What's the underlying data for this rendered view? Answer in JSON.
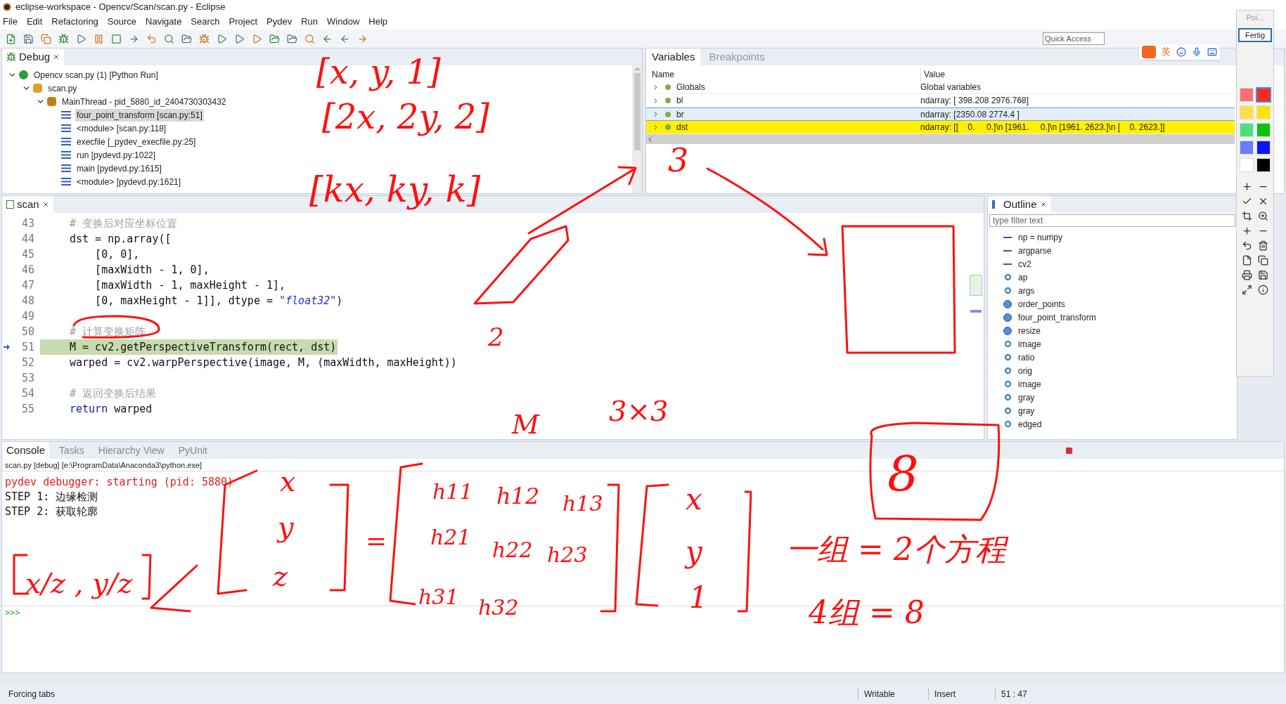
{
  "window": {
    "title": "eclipse-workspace - Opencv/Scan/scan.py - Eclipse"
  },
  "menu": [
    "File",
    "Edit",
    "Refactoring",
    "Source",
    "Navigate",
    "Search",
    "Project",
    "Pydev",
    "Run",
    "Window",
    "Help"
  ],
  "quick_access": {
    "placeholder": "Quick Access"
  },
  "ime_bar": {
    "mode": "英"
  },
  "palette": {
    "title": "Poi...",
    "done_button": "Fertig",
    "swatches": [
      {
        "color": "#f87171",
        "selected": false
      },
      {
        "color": "#ff2a1a",
        "selected": true
      },
      {
        "color": "#fde047",
        "selected": false
      },
      {
        "color": "#ffe600",
        "selected": false
      },
      {
        "color": "#4ade80",
        "selected": false
      },
      {
        "color": "#10c010",
        "selected": false
      },
      {
        "color": "#6b7cff",
        "selected": false
      },
      {
        "color": "#0a14ff",
        "selected": false
      },
      {
        "color": "#ffffff",
        "selected": false
      },
      {
        "color": "#000000",
        "selected": false
      }
    ]
  },
  "debug": {
    "title": "Debug",
    "tree": [
      {
        "label": "Opencv scan.py (1) [Python Run]",
        "kind": "launch",
        "expanded": true,
        "selected": false,
        "children": [
          {
            "label": "scan.py",
            "kind": "process",
            "expanded": true,
            "selected": false,
            "children": [
              {
                "label": "MainThread - pid_5880_id_2404730303432",
                "kind": "thread",
                "expanded": true,
                "selected": false,
                "children": [
                  {
                    "label": "four_point_transform [scan.py:51]",
                    "kind": "frame",
                    "selected": true
                  },
                  {
                    "label": "<module> [scan.py:118]",
                    "kind": "frame",
                    "selected": false
                  },
                  {
                    "label": "execfile [_pydev_execfile.py:25]",
                    "kind": "frame",
                    "selected": false
                  },
                  {
                    "label": "run [pydevd.py:1022]",
                    "kind": "frame",
                    "selected": false
                  },
                  {
                    "label": "main [pydevd.py:1615]",
                    "kind": "frame",
                    "selected": false
                  },
                  {
                    "label": "<module> [pydevd.py:1621]",
                    "kind": "frame",
                    "selected": false
                  }
                ]
              }
            ]
          }
        ]
      }
    ]
  },
  "variables": {
    "tabs": [
      {
        "label": "Variables",
        "selected": true
      },
      {
        "label": "Breakpoints",
        "selected": false
      }
    ],
    "columns": [
      "Name",
      "Value"
    ],
    "rows": [
      {
        "name": "Globals",
        "value": "Global variables",
        "selected": false,
        "changed": false
      },
      {
        "name": "bl",
        "value": "ndarray: [ 398.208 2976.768]",
        "selected": false,
        "changed": false
      },
      {
        "name": "br",
        "value": "ndarray: [2350.08 2774.4 ]",
        "selected": true,
        "changed": false
      },
      {
        "name": "dst",
        "value": "ndarray: [[    0.     0.]\\n [1961.     0.]\\n [1961. 2623.]\\n [    0. 2623.]]",
        "selected": false,
        "changed": true
      }
    ]
  },
  "editor": {
    "tab": "scan",
    "lines": [
      {
        "number": "43",
        "current": false,
        "segments": [
          {
            "text": "# 变换后对应坐标位置",
            "kind": "comment"
          }
        ]
      },
      {
        "number": "44",
        "current": false,
        "segments": [
          {
            "text": "dst = np.array([",
            "kind": "plain"
          }
        ]
      },
      {
        "number": "45",
        "current": false,
        "segments": [
          {
            "text": "    [0, 0],",
            "kind": "plain"
          }
        ]
      },
      {
        "number": "46",
        "current": false,
        "segments": [
          {
            "text": "    [maxWidth - 1, 0],",
            "kind": "plain"
          }
        ]
      },
      {
        "number": "47",
        "current": false,
        "segments": [
          {
            "text": "    [maxWidth - 1, maxHeight - 1],",
            "kind": "plain"
          }
        ]
      },
      {
        "number": "48",
        "current": false,
        "segments": [
          {
            "text": "    [0, maxHeight - 1]], dtype = ",
            "kind": "plain"
          },
          {
            "text": "\"float32\"",
            "kind": "string"
          },
          {
            "text": ")",
            "kind": "plain"
          }
        ]
      },
      {
        "number": "49",
        "current": false
      },
      {
        "number": "50",
        "current": false,
        "segments": [
          {
            "text": "# 计算变换矩阵",
            "kind": "comment"
          }
        ]
      },
      {
        "number": "51",
        "current": true,
        "segments": [
          {
            "text": "M = cv2.getPerspectiveTransform(rect, dst)",
            "kind": "plain"
          }
        ]
      },
      {
        "number": "52",
        "current": false,
        "segments": [
          {
            "text": "warped = cv2.warpPerspective(image, M, (maxWidth, maxHeight))",
            "kind": "plain"
          }
        ]
      },
      {
        "number": "53",
        "current": false
      },
      {
        "number": "54",
        "current": false,
        "segments": [
          {
            "text": "# 返回变换后结果",
            "kind": "comment"
          }
        ]
      },
      {
        "number": "55",
        "current": false,
        "segments": [
          {
            "text": "return",
            "kind": "keyword"
          },
          {
            "text": " warped",
            "kind": "plain"
          }
        ]
      }
    ]
  },
  "outline": {
    "title": "Outline",
    "filter": {
      "placeholder": "type filter text"
    },
    "items": [
      {
        "label": "np = numpy",
        "kind": "import"
      },
      {
        "label": "argparse",
        "kind": "import"
      },
      {
        "label": "cv2",
        "kind": "import"
      },
      {
        "label": "ap",
        "kind": "variable"
      },
      {
        "label": "args",
        "kind": "variable"
      },
      {
        "label": "order_points",
        "kind": "method"
      },
      {
        "label": "four_point_transform",
        "kind": "method"
      },
      {
        "label": "resize",
        "kind": "method"
      },
      {
        "label": "image",
        "kind": "variable"
      },
      {
        "label": "ratio",
        "kind": "variable"
      },
      {
        "label": "orig",
        "kind": "variable"
      },
      {
        "label": "image",
        "kind": "variable"
      },
      {
        "label": "gray",
        "kind": "variable"
      },
      {
        "label": "gray",
        "kind": "variable"
      },
      {
        "label": "edged",
        "kind": "variable"
      }
    ]
  },
  "console": {
    "tabs": [
      {
        "label": "Console",
        "selected": true
      },
      {
        "label": "Tasks",
        "selected": false
      },
      {
        "label": "Hierarchy View",
        "selected": false
      },
      {
        "label": "PyUnit",
        "selected": false
      }
    ],
    "process": "scan.py [debug] [e:\\ProgramData\\Anaconda3\\python.exe]",
    "lines": [
      {
        "text": "pydev debugger: starting (pid: 5880)",
        "kind": "error"
      },
      {
        "text": "STEP 1: 边缘检测",
        "kind": "output"
      },
      {
        "text": "STEP 2: 获取轮廓",
        "kind": "output"
      }
    ],
    "prompt": ">>>"
  },
  "status_bar": {
    "message": "Forcing tabs",
    "state": "Writable",
    "mode": "Insert",
    "position": "51 : 47"
  },
  "annotations": [
    "[x, y, 1]",
    "[2x, 2y, 2]",
    "3",
    "[kx, ky, k]",
    "2",
    "M",
    "3×3",
    "x",
    "h11",
    "h12",
    "h13",
    "x",
    "8",
    "y",
    "=",
    "h21",
    "h22",
    "h23",
    "y",
    "一组 = 2个方程",
    "x/z , y/z",
    "z",
    "h31",
    "h32",
    "1",
    "4组 = 8"
  ]
}
